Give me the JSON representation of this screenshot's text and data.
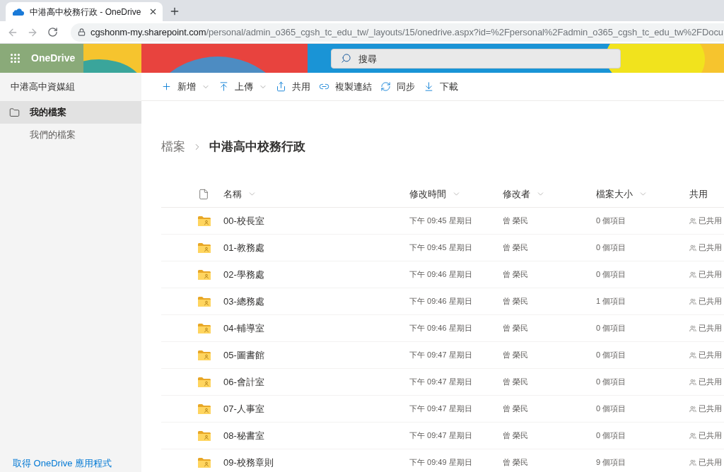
{
  "browser": {
    "tabs": [
      {
        "title": "中港高中校務行政 - OneDrive",
        "selected": true
      }
    ],
    "address_bar": {
      "host": "cgshonm-my.sharepoint.com",
      "path": "/personal/admin_o365_cgsh_tc_edu_tw/_layouts/15/onedrive.aspx?id=%2Fpersonal%2Fadmin_o365_cgsh_tc_edu_tw%2FDocu"
    }
  },
  "app_bar": {
    "app_name": "OneDrive",
    "search": {
      "placeholder": "搜尋"
    }
  },
  "sidebar": {
    "title": "中港高中資媒組",
    "items": [
      {
        "label": "我的檔案",
        "kind": "folder",
        "selected": true
      },
      {
        "label": "我們的檔案",
        "kind": "plain",
        "selected": false
      }
    ],
    "footer_link": "取得 OneDrive 應用程式"
  },
  "command_bar": [
    {
      "label": "新增",
      "dropdown": true
    },
    {
      "label": "上傳",
      "dropdown": true
    },
    {
      "label": "共用",
      "dropdown": false
    },
    {
      "label": "複製連結",
      "dropdown": false
    },
    {
      "label": "同步",
      "dropdown": false
    },
    {
      "label": "下載",
      "dropdown": false
    }
  ],
  "breadcrumb": [
    "檔案",
    "中港高中校務行政"
  ],
  "table": {
    "columns": [
      {
        "label": "名稱",
        "sortable": true
      },
      {
        "label": "修改時間",
        "sortable": true
      },
      {
        "label": "修改者",
        "sortable": true
      },
      {
        "label": "檔案大小",
        "sortable": true
      },
      {
        "label": "共用",
        "sortable": false
      }
    ],
    "rows": [
      {
        "name": "00-校長室",
        "modified": "下午 09:45 星期日",
        "modified_by": "曾 榮民",
        "size": "0 個項目",
        "sharing": "已共用"
      },
      {
        "name": "01-教務處",
        "modified": "下午 09:45 星期日",
        "modified_by": "曾 榮民",
        "size": "0 個項目",
        "sharing": "已共用"
      },
      {
        "name": "02-學務處",
        "modified": "下午 09:46 星期日",
        "modified_by": "曾 榮民",
        "size": "0 個項目",
        "sharing": "已共用"
      },
      {
        "name": "03-總務處",
        "modified": "下午 09:46 星期日",
        "modified_by": "曾 榮民",
        "size": "1 個項目",
        "sharing": "已共用"
      },
      {
        "name": "04-輔導室",
        "modified": "下午 09:46 星期日",
        "modified_by": "曾 榮民",
        "size": "0 個項目",
        "sharing": "已共用"
      },
      {
        "name": "05-圖書館",
        "modified": "下午 09:47 星期日",
        "modified_by": "曾 榮民",
        "size": "0 個項目",
        "sharing": "已共用"
      },
      {
        "name": "06-會計室",
        "modified": "下午 09:47 星期日",
        "modified_by": "曾 榮民",
        "size": "0 個項目",
        "sharing": "已共用"
      },
      {
        "name": "07-人事室",
        "modified": "下午 09:47 星期日",
        "modified_by": "曾 榮民",
        "size": "0 個項目",
        "sharing": "已共用"
      },
      {
        "name": "08-秘書室",
        "modified": "下午 09:47 星期日",
        "modified_by": "曾 榮民",
        "size": "0 個項目",
        "sharing": "已共用"
      },
      {
        "name": "09-校務章則",
        "modified": "下午 09:49 星期日",
        "modified_by": "曾 榮民",
        "size": "9 個項目",
        "sharing": "已共用"
      }
    ]
  }
}
